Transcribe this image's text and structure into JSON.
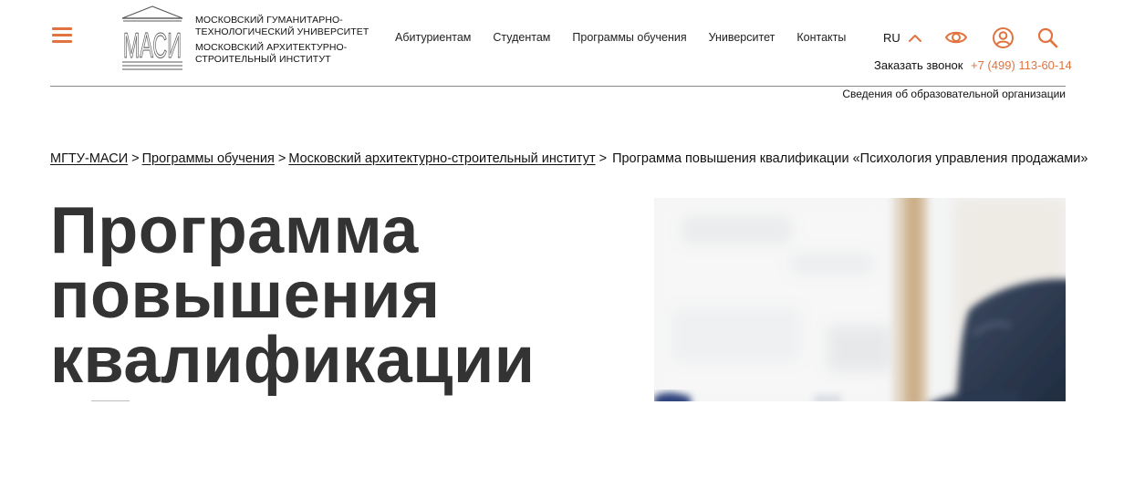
{
  "header": {
    "menu_icon": "hamburger-menu-icon",
    "logo_text": "МАСИ",
    "org_name_1": "МОСКОВСКИЙ ГУМАНИТАРНО-ТЕХНОЛОГИЧЕСКИЙ УНИВЕРСИТЕТ",
    "org_name_2": "МОСКОВСКИЙ АРХИТЕКТУРНО-СТРОИТЕЛЬНЫЙ ИНСТИТУТ",
    "nav": [
      "Абитуриентам",
      "Студентам",
      "Программы обучения",
      "Университет",
      "Контакты"
    ],
    "language": "RU",
    "icons": [
      "chevron-up-icon",
      "eye-icon",
      "user-icon",
      "search-icon"
    ],
    "callback_label": "Заказать звонок",
    "phone": "+7 (499) 113-60-14",
    "edu_info_link": "Сведения об образовательной организации"
  },
  "breadcrumb": {
    "items": [
      "МГТУ-МАСИ",
      "Программы обучения",
      "Московский архитектурно-строительный институт"
    ],
    "separator": ">",
    "current": "Программа повышения квалификации «Психология управления продажами»"
  },
  "hero": {
    "title_lines": [
      "Программа",
      "повышения",
      "квалификации"
    ]
  },
  "colors": {
    "accent": "#e0733f",
    "title": "#333333",
    "text": "#111111",
    "divider": "#8a8a8a"
  }
}
